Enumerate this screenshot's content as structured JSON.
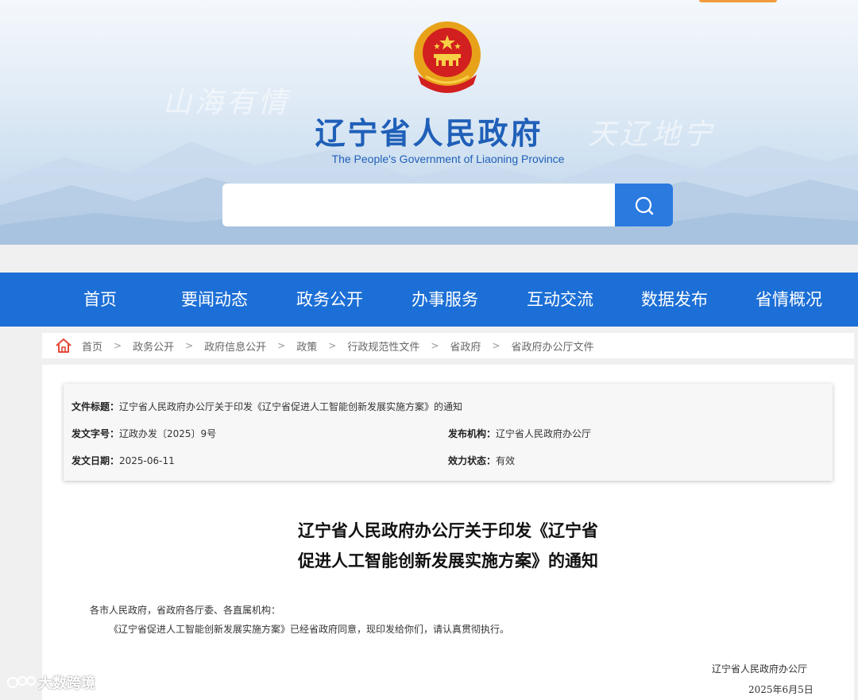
{
  "banner": {
    "title": "辽宁省人民政府",
    "subtitle": "The People's Government of Liaoning Province",
    "calligraphy_left": "山海有情",
    "calligraphy_right": "天辽地宁",
    "search": {
      "placeholder": "",
      "value": ""
    }
  },
  "nav": {
    "items": [
      "首页",
      "要闻动态",
      "政务公开",
      "办事服务",
      "互动交流",
      "数据发布",
      "省情概况"
    ]
  },
  "breadcrumb": {
    "items": [
      "首页",
      "政务公开",
      "政府信息公开",
      "政策",
      "行政规范性文件",
      "省政府",
      "省政府办公厅文件"
    ]
  },
  "meta": {
    "title_label": "文件标题：",
    "title_value": "辽宁省人民政府办公厅关于印发《辽宁省促进人工智能创新发展实施方案》的通知",
    "doc_no_label": "发文字号：",
    "doc_no_value": "辽政办发〔2025〕9号",
    "issuer_label": "发布机构：",
    "issuer_value": "辽宁省人民政府办公厅",
    "date_label": "发文日期：",
    "date_value": "2025-06-11",
    "status_label": "效力状态：",
    "status_value": "有效"
  },
  "document": {
    "title_line1": "辽宁省人民政府办公厅关于印发《辽宁省",
    "title_line2": "促进人工智能创新发展实施方案》的通知",
    "salutation": "各市人民政府，省政府各厅委、各直属机构：",
    "paragraph1": "《辽宁省促进人工智能创新发展实施方案》已经省政府同意，现印发给你们，请认真贯彻执行。",
    "signature": "辽宁省人民政府办公厅",
    "sign_date": "2025年6月5日"
  },
  "watermark": {
    "text": "大数跨境"
  },
  "colors": {
    "nav_bg": "#1c6fd6",
    "title_blue": "#1f5fb8",
    "search_btn": "#2a7ae0",
    "accent_orange": "#f19a3b"
  }
}
